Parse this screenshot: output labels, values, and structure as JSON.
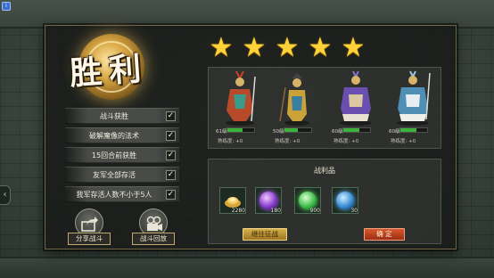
{
  "result": {
    "title": "胜利"
  },
  "objectives": [
    {
      "label": "战斗获胜",
      "done": "✓"
    },
    {
      "label": "破解魔像的法术",
      "done": "✓"
    },
    {
      "label": "15回合前获胜",
      "done": "✓"
    },
    {
      "label": "友军全部存活",
      "done": "✓"
    },
    {
      "label": "我军存活人数不小于5人",
      "done": "✓"
    }
  ],
  "actions": {
    "share_label": "分享战斗",
    "replay_label": "战斗回放"
  },
  "stars": {
    "count": 5,
    "glyph": "★"
  },
  "heroes": [
    {
      "level": "61级",
      "exp_label": "熟练度: +0",
      "exp_fraction": 0.55,
      "color": "#b84a2c"
    },
    {
      "level": "50级",
      "exp_label": "熟练度: +0",
      "exp_fraction": 0.5,
      "color": "#c9a23a"
    },
    {
      "level": "60级",
      "exp_label": "熟练度: +0",
      "exp_fraction": 0.6,
      "color": "#6a4fb0"
    },
    {
      "level": "60级",
      "exp_label": "熟练度: +0",
      "exp_fraction": 0.6,
      "color": "#4f8fb5"
    }
  ],
  "loot": {
    "title": "战利品",
    "items": [
      {
        "icon": "gold-ingot-icon",
        "count": "2280",
        "color": "#d9a63a"
      },
      {
        "icon": "purple-orb-icon",
        "count": "180",
        "color": "#8a3fd0"
      },
      {
        "icon": "green-jade-icon",
        "count": "900",
        "color": "#3fbf4a"
      },
      {
        "icon": "blue-gem-icon",
        "count": "30",
        "color": "#3a8fd8"
      }
    ]
  },
  "buttons": {
    "continue_label": "继往征战",
    "confirm_label": "确 定"
  },
  "colors": {
    "accent_gold": "#ffd23a",
    "check_bg": "#1b1d1a",
    "confirm_red": "#c0411f"
  }
}
